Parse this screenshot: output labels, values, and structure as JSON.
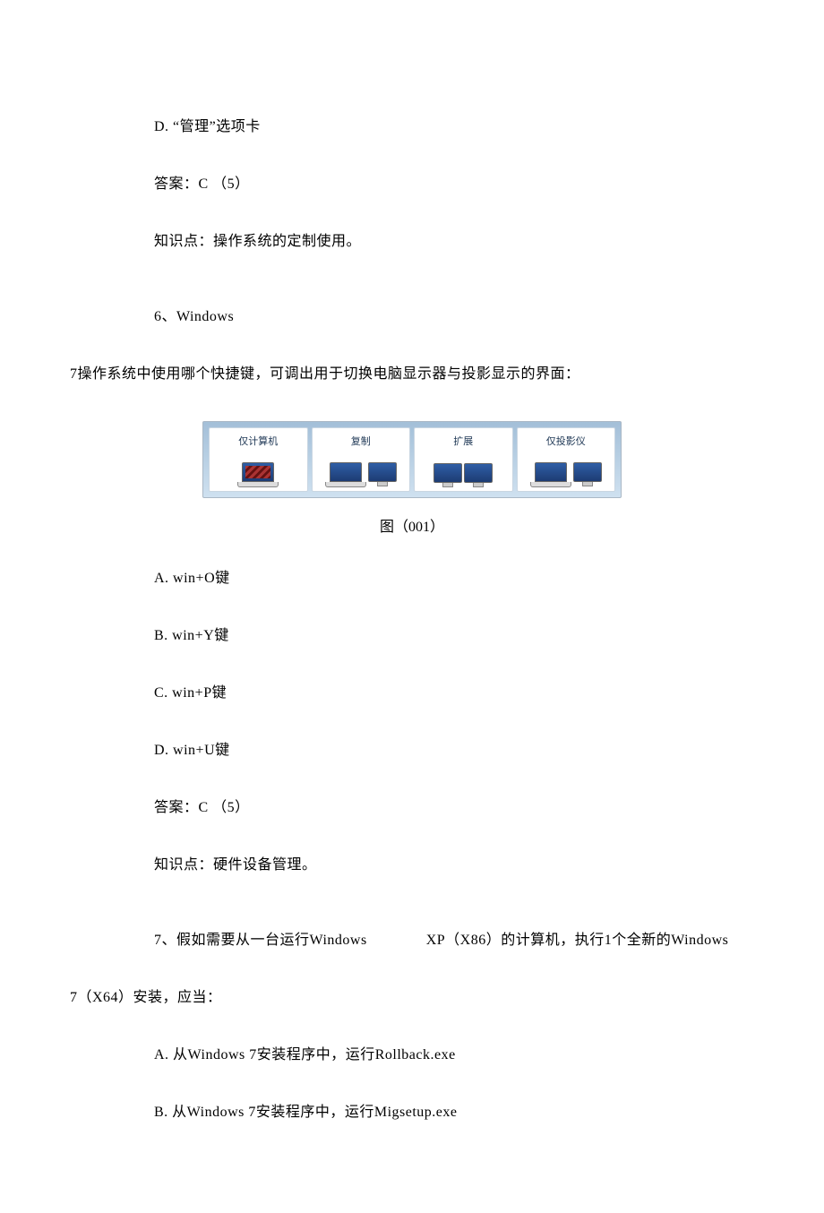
{
  "lines": {
    "d_option": "D. “管理”选项卡",
    "answer5": "答案：C （5）",
    "kp5": "知识点：操作系统的定制使用。",
    "q6a": "6、Windows",
    "q6b": "7操作系统中使用哪个快捷键，可调出用于切换电脑显示器与投影显示的界面：",
    "fig_caption": "图（001）",
    "a6": "A. win+O键",
    "b6": "B. win+Y键",
    "c6": "C. win+P键",
    "d6": "D. win+U键",
    "answer6": "答案：C （5）",
    "kp6": "知识点：硬件设备管理。",
    "q7": "7、假如需要从一台运行Windows　　　　XP（X86）的计算机，执行1个全新的Windows",
    "q7b": "7（X64）安装，应当：",
    "a7": "A. 从Windows 7安装程序中，运行Rollback.exe",
    "b7": "B. 从Windows 7安装程序中，运行Migsetup.exe"
  },
  "tiles": {
    "t1": "仅计算机",
    "t2": "复制",
    "t3": "扩展",
    "t4": "仅投影仪"
  }
}
